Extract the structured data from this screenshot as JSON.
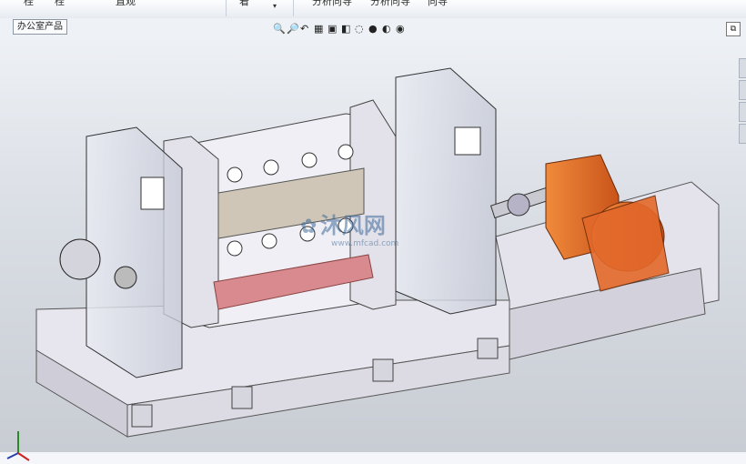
{
  "command_bar": {
    "items": [
      "桂",
      "桂",
      "直观",
      "着",
      "分析向导",
      "分析向导",
      "向导"
    ]
  },
  "document_tab": {
    "label": "办公室产品"
  },
  "watermark": {
    "brand": "沐风网",
    "url": "www.mfcad.com"
  },
  "headsup_icons": [
    "zoom-fit-icon",
    "zoom-area-icon",
    "previous-view-icon",
    "section-view-icon",
    "view-orientation-icon",
    "display-style-icon",
    "hide-show-icon",
    "appearance-icon",
    "scene-icon",
    "view-settings-icon"
  ],
  "colors": {
    "motor": "#e0661f",
    "roller": "#d98a8e",
    "frame": "#eceaf2",
    "viewport_top": "#eef1f5"
  }
}
